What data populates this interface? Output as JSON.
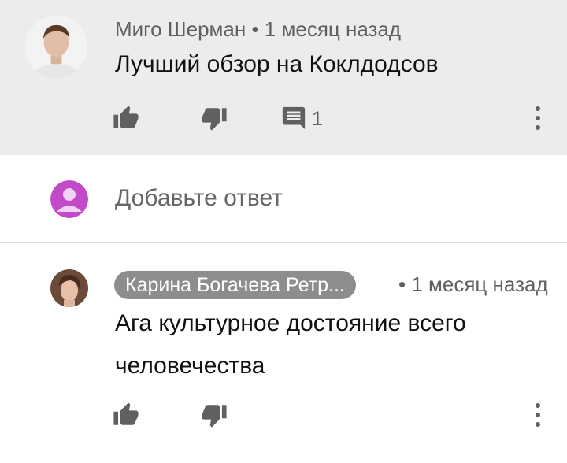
{
  "comment": {
    "author": "Миго Шерман",
    "time": "• 1 месяц назад",
    "text": "Лучший обзор на Коклдодсов",
    "reply_count": "1",
    "icons": {
      "like": "thumb-up-icon",
      "dislike": "thumb-down-icon",
      "replies": "comment-icon",
      "menu": "more-vertical-icon"
    }
  },
  "reply_box": {
    "placeholder": "Добавьте ответ",
    "avatar_color": "#c24ac9"
  },
  "reply": {
    "author": "Карина Богачева Ретр...",
    "time": "• 1 месяц назад",
    "text": "Ага культурное достояние всего человечества"
  },
  "colors": {
    "highlight_bg": "#ececec",
    "pill_bg": "#8d8d8d",
    "icon": "#606060"
  }
}
